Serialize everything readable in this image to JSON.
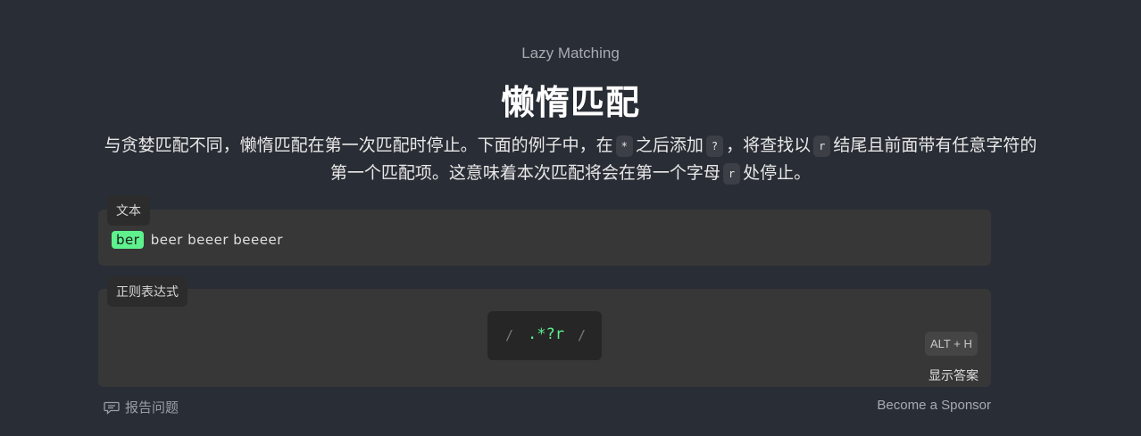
{
  "lesson": {
    "subtitle": "Lazy Matching",
    "title": "懒惰匹配",
    "description_parts": [
      "与贪婪匹配不同，懒惰匹配在第一次匹配时停止。下面的例子中，在",
      "*",
      "之后添加",
      "?",
      "，将查找以",
      "r",
      "结尾且前面带有任意字符的第一个匹配项。这意味着本次匹配将会在第一个字母",
      "r",
      "处停止。"
    ]
  },
  "text_panel": {
    "label": "文本",
    "match": "ber",
    "rest": "beer beeer beeeer"
  },
  "regex_panel": {
    "label": "正则表达式",
    "slash_open": "/",
    "slash_close": "/",
    "value": ".*?r"
  },
  "hint": {
    "shortcut": "ALT + H",
    "label": "显示答案"
  },
  "footer": {
    "report_label": "报告问题",
    "report_icon": "comment-icon",
    "sponsor_label": "Become a Sponsor"
  },
  "colors": {
    "background": "#292d35",
    "match_highlight": "#5ef18e",
    "regex_text": "#5ef18e"
  }
}
